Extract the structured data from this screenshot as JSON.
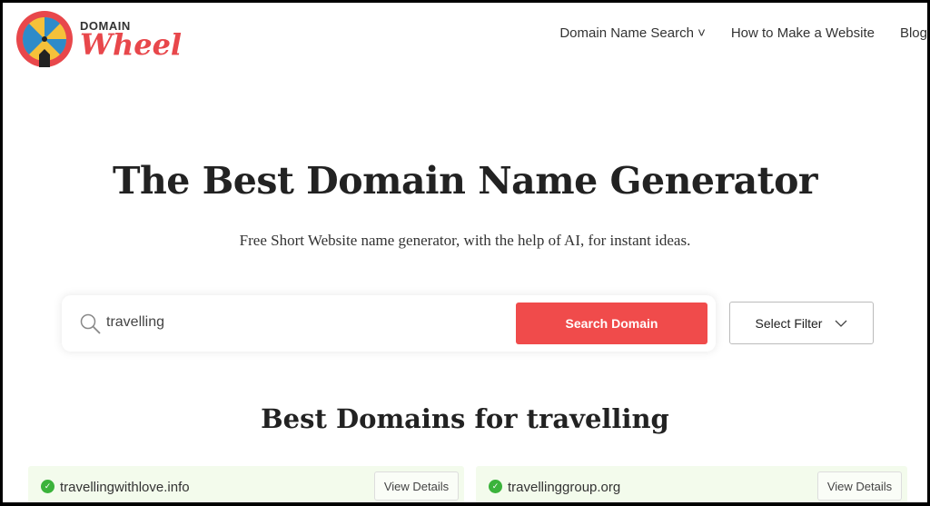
{
  "brand": {
    "top": "DOMAIN",
    "bottom": "Wheel"
  },
  "nav": {
    "items": [
      {
        "label": "Domain Name Search ˅"
      },
      {
        "label": "How to Make a Website"
      },
      {
        "label": "Blog"
      }
    ]
  },
  "hero": {
    "title": "The Best Domain Name Generator",
    "subtitle": "Free Short Website name generator, with the help of AI, for instant ideas."
  },
  "search": {
    "value": "travelling",
    "button": "Search Domain",
    "filter": "Select Filter"
  },
  "results": {
    "prefix": "Best Domains for ",
    "keyword": "travelling",
    "items": [
      {
        "domain": "travellingwithlove.info",
        "action": "View Details",
        "status": "available"
      },
      {
        "domain": "travellinggroup.org",
        "action": "View Details",
        "status": "available"
      }
    ]
  },
  "colors": {
    "accent": "#f04b4b",
    "available": "#3bb33b",
    "card_bg": "#f3fbec"
  }
}
